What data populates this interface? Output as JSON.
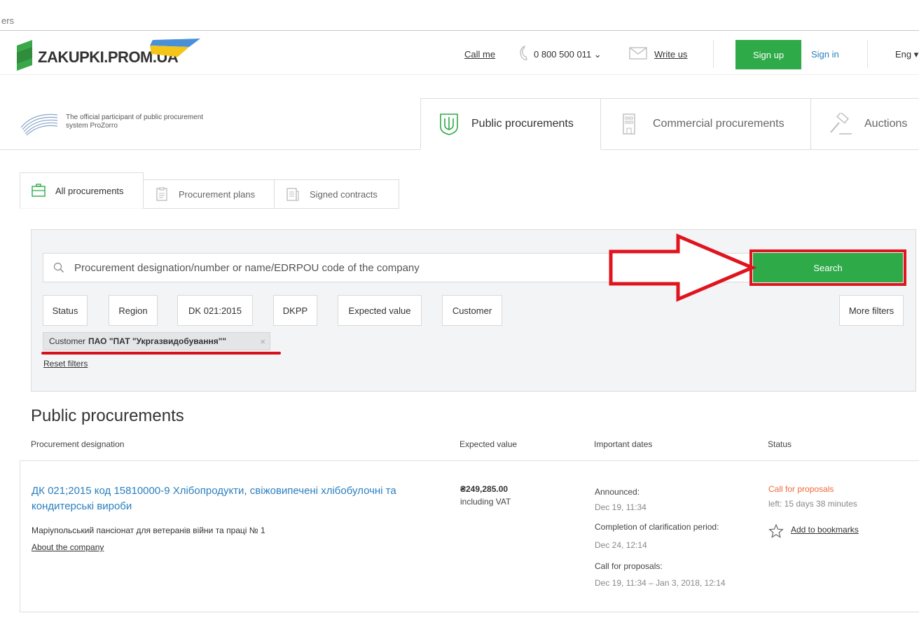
{
  "browser": {
    "partial_text": "ers"
  },
  "header": {
    "logo_text": "ZAKUPKI.PROM.UA",
    "call_me": "Call me",
    "phone": "0 800 500 011 ⌄",
    "write_us": "Write us",
    "sign_up": "Sign up",
    "sign_in": "Sign in",
    "language": "Eng ▾"
  },
  "ministry": {
    "text": "The official participant of public procurement system ProZorro"
  },
  "main_tabs": [
    {
      "label": "Public procurements",
      "active": true
    },
    {
      "label": "Commercial procurements",
      "active": false
    },
    {
      "label": "Auctions",
      "active": false
    }
  ],
  "sub_tabs": [
    {
      "label": "All procurements",
      "active": true
    },
    {
      "label": "Procurement plans",
      "active": false
    },
    {
      "label": "Signed contracts",
      "active": false
    }
  ],
  "search": {
    "placeholder": "Procurement designation/number or name/EDRPOU code of the company",
    "button": "Search"
  },
  "filters": [
    "Status",
    "Region",
    "DK 021:2015",
    "DKPP",
    "Expected value",
    "Customer"
  ],
  "more_filters": "More filters",
  "active_filter": {
    "prefix": "Customer",
    "value": "ПАО \"ПАТ \"Укргазвидобування\"\"",
    "close": "×"
  },
  "reset_filters": "Reset filters",
  "results": {
    "title": "Public procurements",
    "columns": [
      "Procurement designation",
      "Expected value",
      "Important dates",
      "Status"
    ],
    "items": [
      {
        "title": "ДК 021;2015 код 15810000-9 Хлібопродукти, свіжовипечені хлібобулочні та кондитерські вироби",
        "customer": "Маріупольський пансіонат для ветеранів війни та праці № 1",
        "about": "About the company",
        "value": "₴249,285.00",
        "vat": "including VAT",
        "dates": [
          {
            "label": "Announced:",
            "value": "Dec 19, 11:34"
          },
          {
            "label": "Completion of clarification period:",
            "value": "Dec 24, 12:14"
          },
          {
            "label": "Call for proposals:",
            "value": "Dec 19, 11:34 – Jan 3, 2018, 12:14"
          }
        ],
        "status": "Call for proposals",
        "time_left": "left: 15 days 38 minutes",
        "bookmark": "Add to bookmarks"
      }
    ]
  },
  "colors": {
    "accent_green": "#2eaa48",
    "link_blue": "#2a7fc0",
    "status_orange": "#f06a3a",
    "annotation_red": "#e0141e"
  }
}
